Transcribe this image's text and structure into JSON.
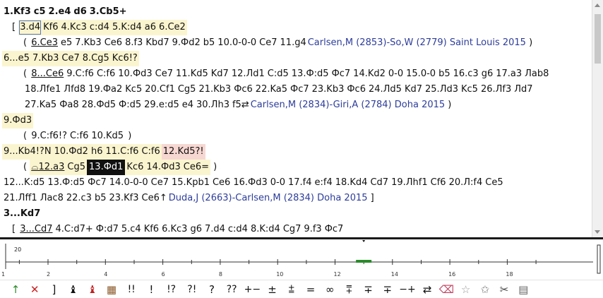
{
  "notation": {
    "line1": [
      "1.Kf3",
      "c5",
      "2.e4",
      "d6",
      "3.Cb5+"
    ],
    "line2": [
      "3.d4",
      "Kf6",
      "4.Kc3",
      "c:d4",
      "5.K:d4",
      "a6",
      "6.Ce2"
    ],
    "line3": {
      "moves": [
        "6.Ce3",
        "e5",
        "7.Kb3",
        "Ce6",
        "8.f3",
        "Kbd7",
        "9.Фd2",
        "b5",
        "10.0-0-0",
        "Ce7",
        "11.g4"
      ],
      "game": "Carlsen,M (2853)-So,W (2779) Saint Louis 2015"
    },
    "line4": [
      "6...e5",
      "7.Kb3",
      "Ce7",
      "8.Cg5",
      "Kc6!?"
    ],
    "line5": [
      "8...Ce6",
      "9.C:f6",
      "C:f6",
      "10.Фd3",
      "Ce7",
      "11.Kd5",
      "Kd7",
      "12.Лd1",
      "C:d5",
      "13.Ф:d5",
      "Фc7",
      "14.Kd2",
      "0-0",
      "15.0-0",
      "b5",
      "16.c3",
      "g6",
      "17.a3",
      "Лab8"
    ],
    "line6": [
      "18.Лfe1",
      "Лfd8",
      "19.Фa2",
      "Kc5",
      "20.Cf1",
      "Cg5",
      "21.Kb3",
      "Фc6",
      "22.Ka5",
      "Фc7",
      "23.Kb3",
      "Фc6",
      "24.Лd5",
      "Kd7",
      "25.Лd3",
      "Kc5",
      "26.Лf3",
      "Лd7"
    ],
    "line7": {
      "moves": [
        "27.Ka5",
        "Фa8",
        "28.Фd5",
        "Ф:d5",
        "29.e:d5",
        "e4",
        "30.Лh3",
        "f5⇄"
      ],
      "game": "Carlsen,M (2834)-Giri,A (2784) Doha 2015"
    },
    "line8": [
      "9.Фd3"
    ],
    "line9": [
      "9.C:f6!?",
      "C:f6",
      "10.Kd5"
    ],
    "line10": {
      "moves": [
        "9...Kb4!?N",
        "10.Фd2",
        "h6",
        "11.C:f6",
        "C:f6"
      ],
      "pink": "12.Kd5?!"
    },
    "line11": [
      "⌓12.a3",
      "Cg5",
      "13.Фd1",
      "Kc6",
      "14.Фd3",
      "Ce6="
    ],
    "line12": [
      "12...K:d5",
      "13.Ф:d5",
      "Фc7",
      "14.0-0-0",
      "Ce7",
      "15.Kpb1",
      "Ce6",
      "16.Фd3",
      "0-0",
      "17.f4",
      "e:f4",
      "18.Kd4",
      "Cd7",
      "19.Лhf1",
      "Cf6",
      "20.Л:f4",
      "Ce5"
    ],
    "line13": {
      "moves": [
        "21.Лff1",
        "Лac8",
        "22.c3",
        "b5",
        "23.Kf3",
        "Ce6↑"
      ],
      "game": "Duda,J (2663)-Carlsen,M (2834) Doha 2015"
    },
    "line14": [
      "3...Kd7"
    ],
    "line15": [
      "3...Cd7",
      "4.C:d7+",
      "Ф:d7",
      "5.c4",
      "Kf6",
      "6.Kc3",
      "g6",
      "7.d4",
      "c:d4",
      "8.K:d4",
      "Cg7",
      "9.f3",
      "Фc7"
    ]
  },
  "timeline": {
    "top_label": "20",
    "ticks": [
      2,
      4,
      6,
      8,
      10,
      12,
      14,
      16,
      18
    ],
    "start_label": "1",
    "current_move": 13
  },
  "toolbar": [
    {
      "name": "good-move-arrow-icon",
      "glyph": "↑",
      "color": "#2e8b2e"
    },
    {
      "name": "delete-variation-icon",
      "glyph": "✕",
      "color": "#cc2222"
    },
    {
      "name": "bracket-icon",
      "glyph": "]",
      "color": "#111"
    },
    {
      "name": "black-piece-icon",
      "glyph": "♝",
      "color": "#111"
    },
    {
      "name": "red-piece-icon",
      "glyph": "♝",
      "color": "#c02020"
    },
    {
      "name": "board-icon",
      "glyph": "▦",
      "color": "#8a5a2a"
    },
    {
      "name": "annotation-brilliant",
      "glyph": "!!",
      "color": "#111"
    },
    {
      "name": "annotation-good",
      "glyph": "!",
      "color": "#111"
    },
    {
      "name": "annotation-interesting",
      "glyph": "!?",
      "color": "#111"
    },
    {
      "name": "annotation-dubious",
      "glyph": "?!",
      "color": "#111"
    },
    {
      "name": "annotation-mistake",
      "glyph": "?",
      "color": "#111"
    },
    {
      "name": "annotation-blunder",
      "glyph": "??",
      "color": "#111"
    },
    {
      "name": "eval-black-winning",
      "glyph": "+−",
      "color": "#111"
    },
    {
      "name": "eval-white-better",
      "glyph": "±",
      "color": "#111"
    },
    {
      "name": "eval-white-slightly",
      "glyph": "⩲",
      "color": "#111"
    },
    {
      "name": "eval-equal",
      "glyph": "=",
      "color": "#111"
    },
    {
      "name": "eval-unclear",
      "glyph": "∞",
      "color": "#111"
    },
    {
      "name": "eval-compensation",
      "glyph": "⩱",
      "color": "#111"
    },
    {
      "name": "eval-black-slightly",
      "glyph": "∓",
      "color": "#111"
    },
    {
      "name": "eval-black-better",
      "glyph": "∓",
      "color": "#111"
    },
    {
      "name": "eval-black-decisive",
      "glyph": "−+",
      "color": "#111"
    },
    {
      "name": "counterplay-icon",
      "glyph": "⇄",
      "color": "#111"
    },
    {
      "name": "eraser-icon",
      "glyph": "⌫",
      "color": "#c04060"
    },
    {
      "name": "star-icon",
      "glyph": "☆",
      "color": "#999"
    },
    {
      "name": "star-plus-icon",
      "glyph": "✩",
      "color": "#777"
    },
    {
      "name": "tools-icon",
      "glyph": "✂",
      "color": "#444"
    },
    {
      "name": "engine-icon",
      "glyph": "▤",
      "color": "#666"
    }
  ]
}
